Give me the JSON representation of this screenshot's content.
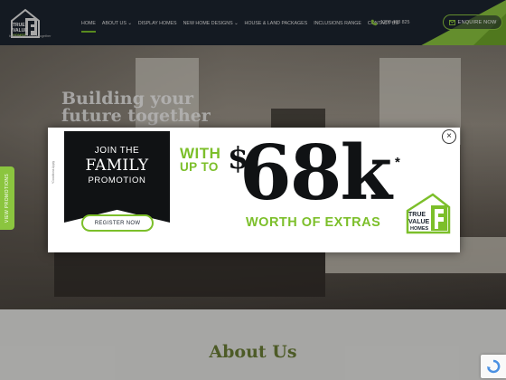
{
  "header": {
    "logo_text": "TRUE VALUE HOMES",
    "logo_tagline": "building your future together",
    "nav": [
      {
        "label": "Home",
        "active": true
      },
      {
        "label": "About Us ⌄",
        "active": false
      },
      {
        "label": "Display Homes",
        "active": false
      },
      {
        "label": "New Home Designs ⌄",
        "active": false
      },
      {
        "label": "House & Land Packages",
        "active": false
      },
      {
        "label": "Inclusions Range",
        "active": false
      },
      {
        "label": "Contact Us",
        "active": false
      }
    ],
    "phone": "1300 408 825",
    "enquire_label": "ENQUIRE NOW"
  },
  "hero": {
    "title_line1": "Building your",
    "title_line2": "future together"
  },
  "side_tab": {
    "label": "View Promotions"
  },
  "about": {
    "title": "About Us"
  },
  "modal": {
    "banner_line1": "JOIN THE",
    "banner_line2": "FAMILY",
    "banner_line3": "PROMOTION",
    "tc_note": "*Conditions Apply",
    "register_label": "REGISTER NOW",
    "with": "WITH",
    "up_to": "UP TO",
    "currency": "$",
    "amount": "68k",
    "asterisk": "*",
    "extras": "WORTH OF EXTRAS",
    "logo_text": "TRUE VALUE HOMES",
    "close": "×"
  },
  "colors": {
    "accent_green": "#8bc53f",
    "header_bg": "#1d2530",
    "heading_olive": "#6b7f36"
  }
}
